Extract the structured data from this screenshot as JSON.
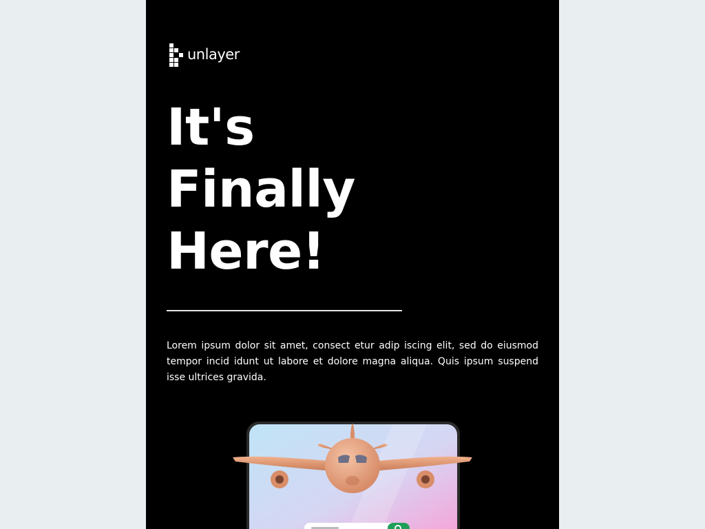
{
  "brand": {
    "logo_text": "unlayer",
    "logo_icon": "unlayer-pixel-logo-icon"
  },
  "hero": {
    "headline_lines": [
      "It's",
      "Finally",
      "Here!"
    ],
    "body": "Lorem ipsum dolor sit amet, consect etur adip iscing elit, sed do eiusmod tempor incid idunt ut labore et dolore magna aliqua. Quis ipsum suspend isse ultrices gravida.",
    "illustration": "airplane-over-phone-illustration"
  },
  "colors": {
    "page_background": "#e9eef0",
    "email_background": "#000000",
    "text": "#ffffff",
    "divider": "#e8e8e8",
    "plane": "#e7a37f",
    "search_button": "#1fa05a"
  }
}
